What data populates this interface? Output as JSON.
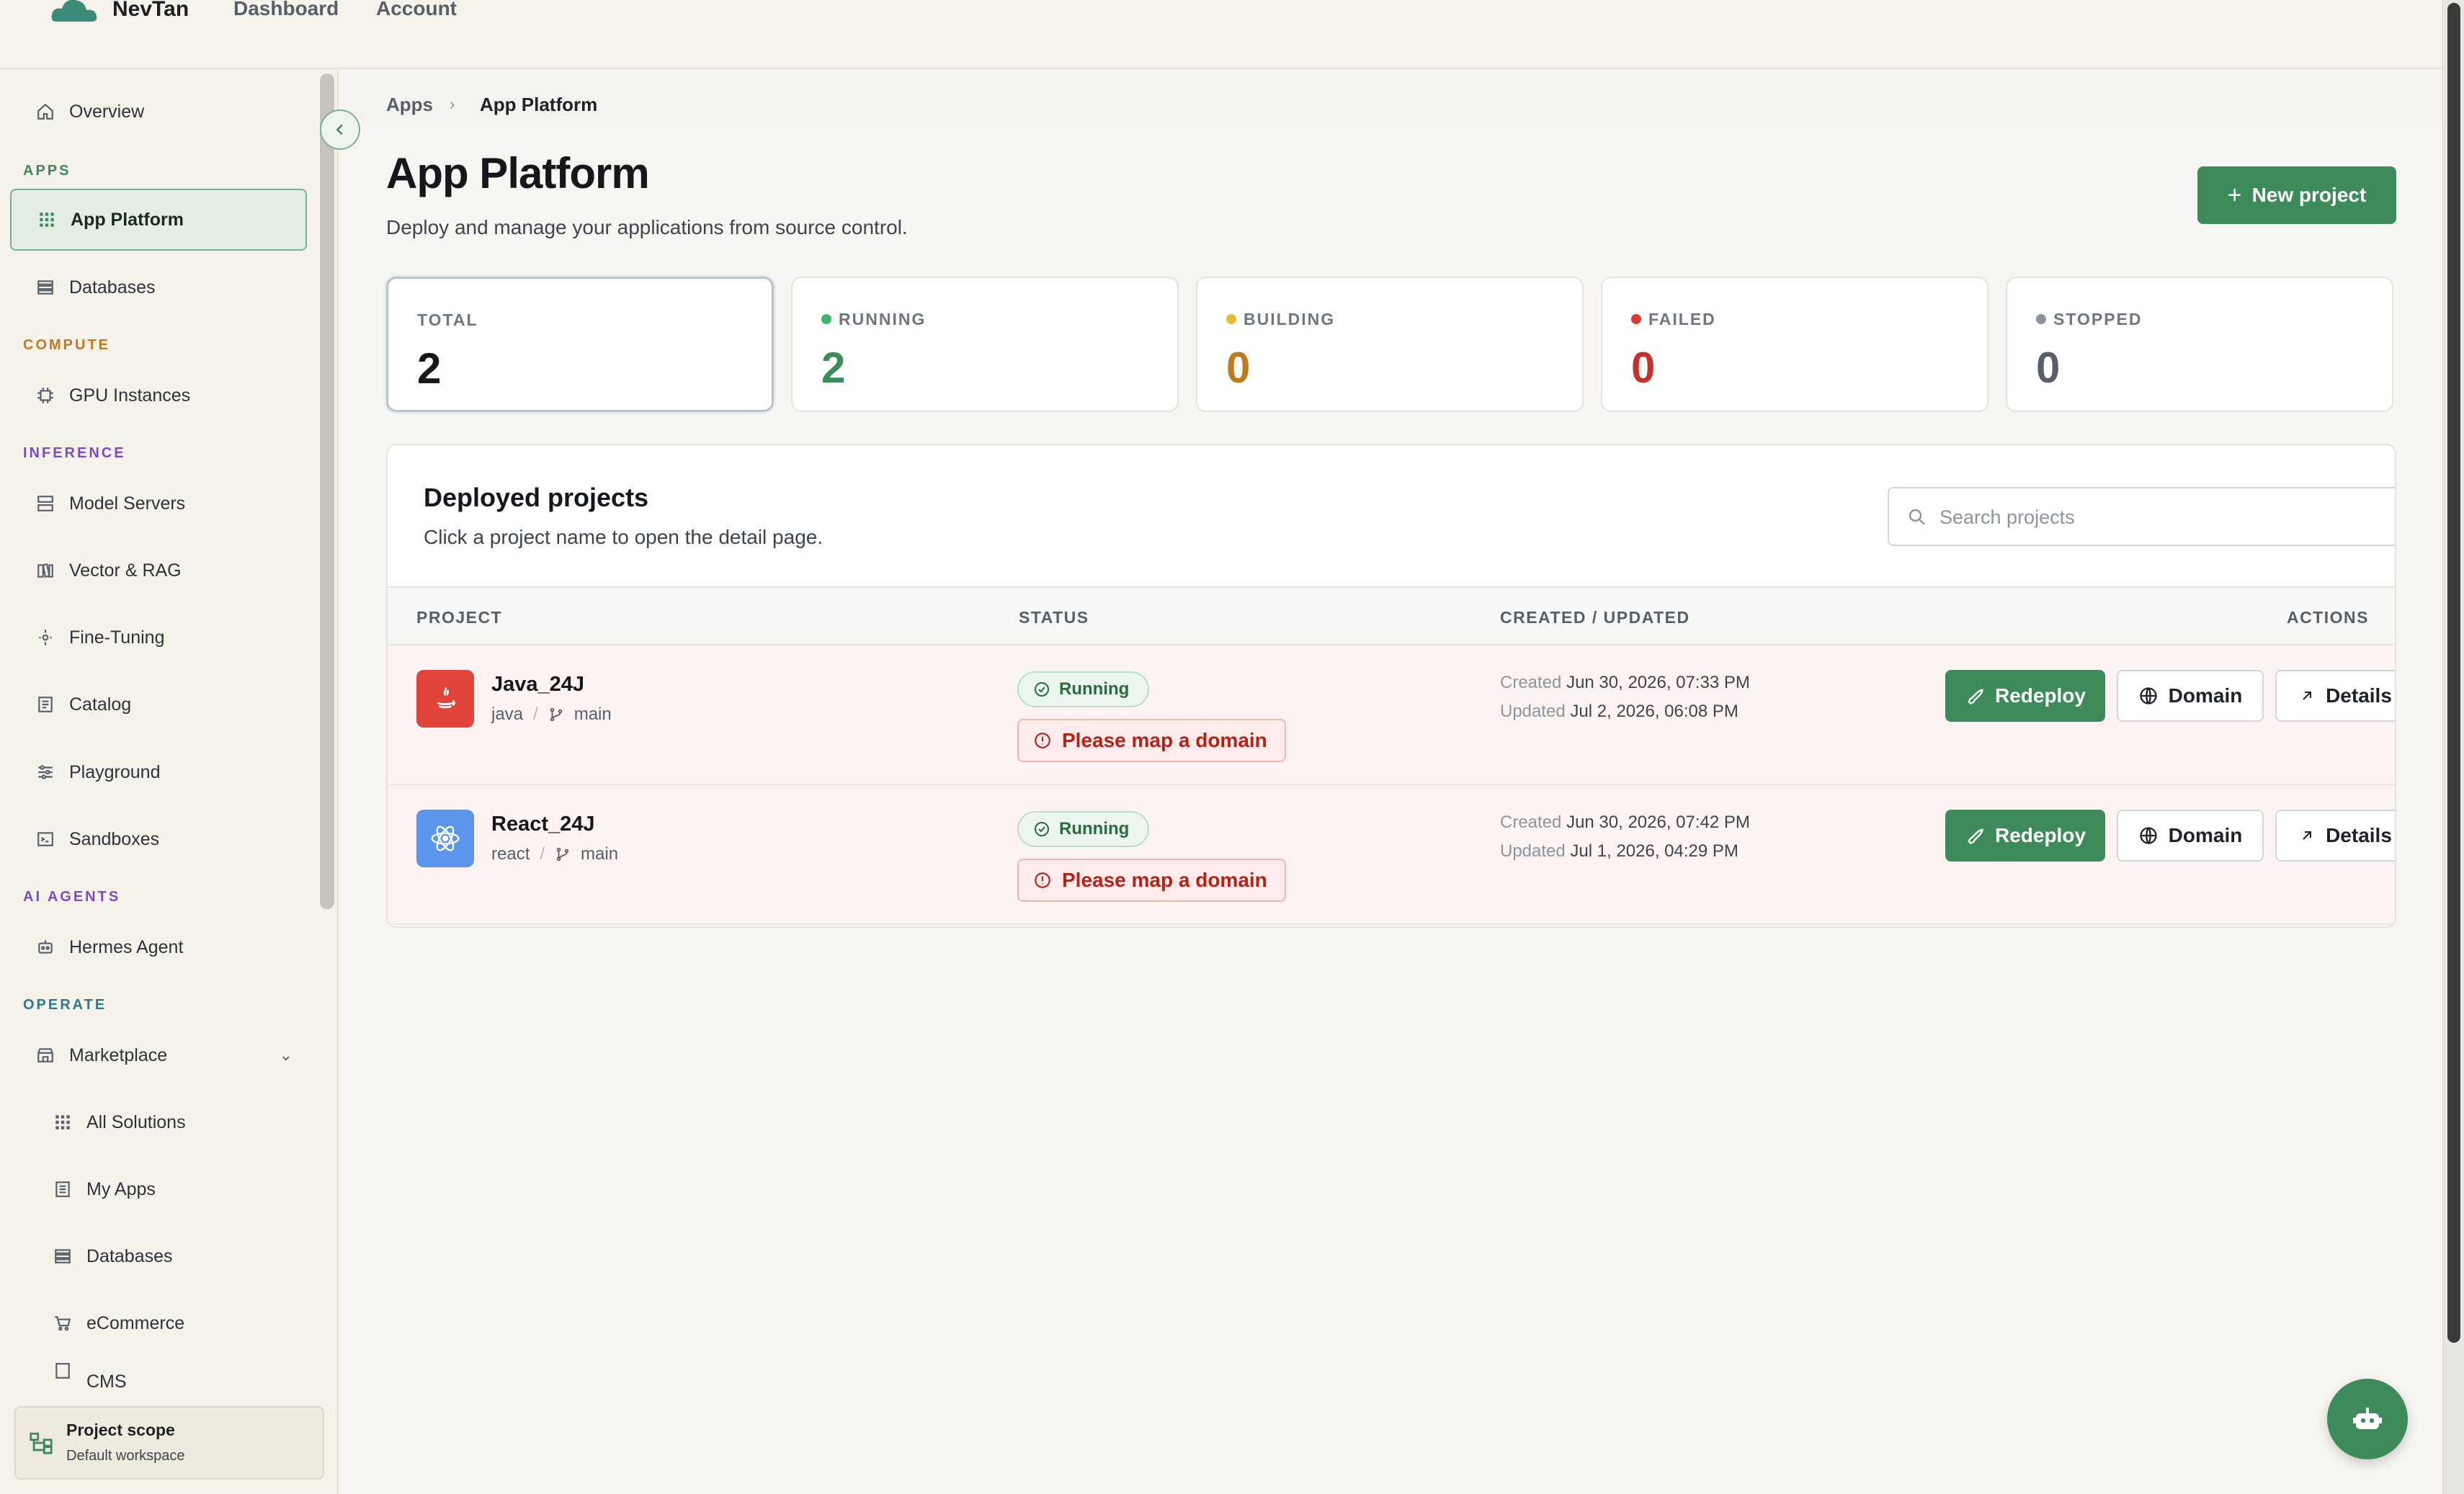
{
  "topbar": {
    "brand": "NevTan",
    "nav": [
      "Dashboard",
      "Account"
    ]
  },
  "sidebar": {
    "overview": "Overview",
    "sections": {
      "apps": "APPS",
      "compute": "COMPUTE",
      "inference": "INFERENCE",
      "ai_agents": "AI AGENTS",
      "operate": "OPERATE"
    },
    "items": {
      "app_platform": "App Platform",
      "databases": "Databases",
      "gpu_instances": "GPU Instances",
      "model_servers": "Model Servers",
      "vector_rag": "Vector & RAG",
      "fine_tuning": "Fine-Tuning",
      "catalog": "Catalog",
      "playground": "Playground",
      "sandboxes": "Sandboxes",
      "hermes_agent": "Hermes Agent",
      "marketplace": "Marketplace",
      "all_solutions": "All Solutions",
      "my_apps": "My Apps",
      "mp_databases": "Databases",
      "ecommerce": "eCommerce",
      "cms": "CMS"
    },
    "scope": {
      "title": "Project scope",
      "subtitle": "Default workspace"
    }
  },
  "breadcrumb": {
    "parent": "Apps",
    "separator": "›",
    "current": "App Platform"
  },
  "page": {
    "title": "App Platform",
    "subtitle": "Deploy and manage your applications from source control.",
    "new_button": "New project"
  },
  "stats": [
    {
      "label": "TOTAL",
      "value": "2",
      "color": "#14181d",
      "dot": ""
    },
    {
      "label": "RUNNING",
      "value": "2",
      "color": "#3d8b5a",
      "dot": "#3db56a"
    },
    {
      "label": "BUILDING",
      "value": "0",
      "color": "#c27a1f",
      "dot": "#e8b63a"
    },
    {
      "label": "FAILED",
      "value": "0",
      "color": "#c4322a",
      "dot": "#d93b30"
    },
    {
      "label": "STOPPED",
      "value": "0",
      "color": "#57606a",
      "dot": "#8c959f"
    }
  ],
  "projects_panel": {
    "title": "Deployed projects",
    "subtitle": "Click a project name to open the detail page.",
    "search_placeholder": "Search projects",
    "columns": [
      "PROJECT",
      "STATUS",
      "CREATED / UPDATED",
      "ACTIONS"
    ],
    "rows": [
      {
        "name": "Java_24J",
        "runtime": "java",
        "branch": "main",
        "status": "Running",
        "warning": "Please map a domain",
        "created_label": "Created",
        "created": "Jun 30, 2026, 07:33 PM",
        "updated_label": "Updated",
        "updated": "Jul 2, 2026, 06:08 PM",
        "icon_color": "#e0443a"
      },
      {
        "name": "React_24J",
        "runtime": "react",
        "branch": "main",
        "status": "Running",
        "warning": "Please map a domain",
        "created_label": "Created",
        "created": "Jun 30, 2026, 07:42 PM",
        "updated_label": "Updated",
        "updated": "Jul 1, 2026, 04:29 PM",
        "icon_color": "#5b95ec"
      }
    ],
    "actions": {
      "redeploy": "Redeploy",
      "domain": "Domain",
      "details": "Details"
    }
  },
  "colors": {
    "accent": "#3d8b5a",
    "warning": "#b42318"
  }
}
